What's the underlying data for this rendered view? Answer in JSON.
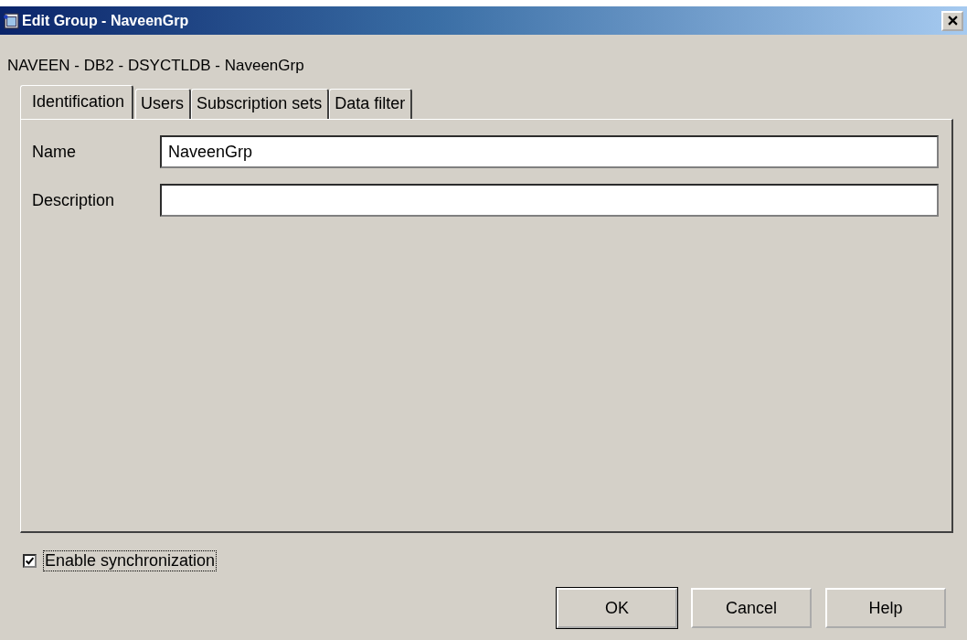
{
  "window": {
    "title": "Edit Group - NaveenGrp"
  },
  "breadcrumb": "NAVEEN - DB2 - DSYCTLDB - NaveenGrp",
  "tabs": [
    {
      "label": "Identification",
      "selected": true
    },
    {
      "label": "Users",
      "selected": false
    },
    {
      "label": "Subscription sets",
      "selected": false
    },
    {
      "label": "Data filter",
      "selected": false
    }
  ],
  "fields": [
    {
      "label": "Name",
      "value": "NaveenGrp"
    },
    {
      "label": "Description"
    }
  ],
  "enable_synchronization": {
    "label": "Enable synchronization",
    "checked": true
  },
  "buttons": [
    {
      "label": "OK",
      "default": true
    },
    {
      "label": "Cancel",
      "default": false
    },
    {
      "label": "Help",
      "default": false
    }
  ]
}
